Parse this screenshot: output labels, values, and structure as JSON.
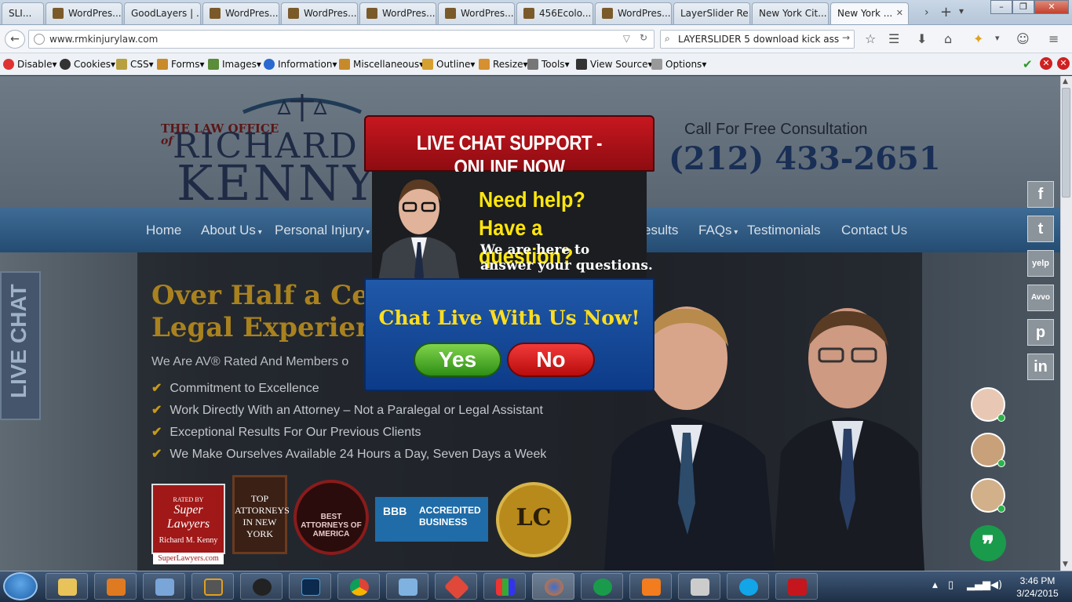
{
  "browser": {
    "tabs": [
      {
        "label": "SLI..."
      },
      {
        "label": "WordPres..."
      },
      {
        "label": "GoodLayers | ..."
      },
      {
        "label": "WordPres..."
      },
      {
        "label": "WordPres..."
      },
      {
        "label": "WordPres..."
      },
      {
        "label": "WordPres..."
      },
      {
        "label": "456Ecolo..."
      },
      {
        "label": "WordPres..."
      },
      {
        "label": "LayerSlider Re..."
      },
      {
        "label": "New York Cit..."
      },
      {
        "label": "New York ..."
      }
    ],
    "url": "www.rmkinjurylaw.com",
    "search": "LAYERSLIDER 5 download kick ass",
    "devbar": [
      "Disable",
      "Cookies",
      "CSS",
      "Forms",
      "Images",
      "Information",
      "Miscellaneous",
      "Outline",
      "Resize",
      "Tools",
      "View Source",
      "Options"
    ]
  },
  "site": {
    "logo_top": "THE LAW OFFICE",
    "logo_of": "of",
    "logo_name1": "RICHARD M.",
    "logo_name2": "KENNY",
    "call_label": "Call For Free Consultation",
    "phone": "(212) 433-2651",
    "menu": [
      "Home",
      "About Us",
      "Personal Injury",
      "esults",
      "FAQs",
      "Testimonials",
      "Contact Us"
    ],
    "headline1": "Over Half a Cen",
    "headline2": "Legal Experienc",
    "rated": "We Are AV® Rated And Members o",
    "checks": [
      "Commitment to Excellence",
      "Work Directly With an Attorney – Not a Paralegal or Legal Assistant",
      "Exceptional Results For Our Previous Clients",
      "We Make Ourselves Available 24 Hours a Day, Seven Days a Week"
    ],
    "badges": {
      "sl_top": "RATED BY",
      "sl_name": "Super Lawyers",
      "sl_person": "Richard M. Kenny",
      "sl_url": "SuperLawyers.com",
      "ta_text": "TOP ATTORNEYS IN NEW YORK",
      "ba_text": "BEST ATTORNEYS OF AMERICA",
      "bbb_text1": "ACCREDITED",
      "bbb_text2": "BUSINESS",
      "bbb_logo": "BBB",
      "lc_text": "LC"
    },
    "live_chat_tab": "LIVE CHAT",
    "social": [
      "f",
      "t",
      "yelp",
      "Avvo",
      "p",
      "in"
    ]
  },
  "modal": {
    "title": "LIVE CHAT SUPPORT - ONLINE NOW",
    "need_help": "Need help?",
    "have_question": "Have a question?",
    "we_here1": "We are here to",
    "we_here2": "answer your questions.",
    "chat_now": "Chat Live With Us Now!",
    "yes": "Yes",
    "no": "No"
  },
  "taskbar": {
    "time": "3:46 PM",
    "date": "3/24/2015"
  },
  "colors": {
    "accent_gold": "#c49a1e",
    "modal_red": "#c71720",
    "modal_blue": "#2059a8",
    "yes_green": "#2e8f16",
    "no_red": "#b80c0c"
  }
}
